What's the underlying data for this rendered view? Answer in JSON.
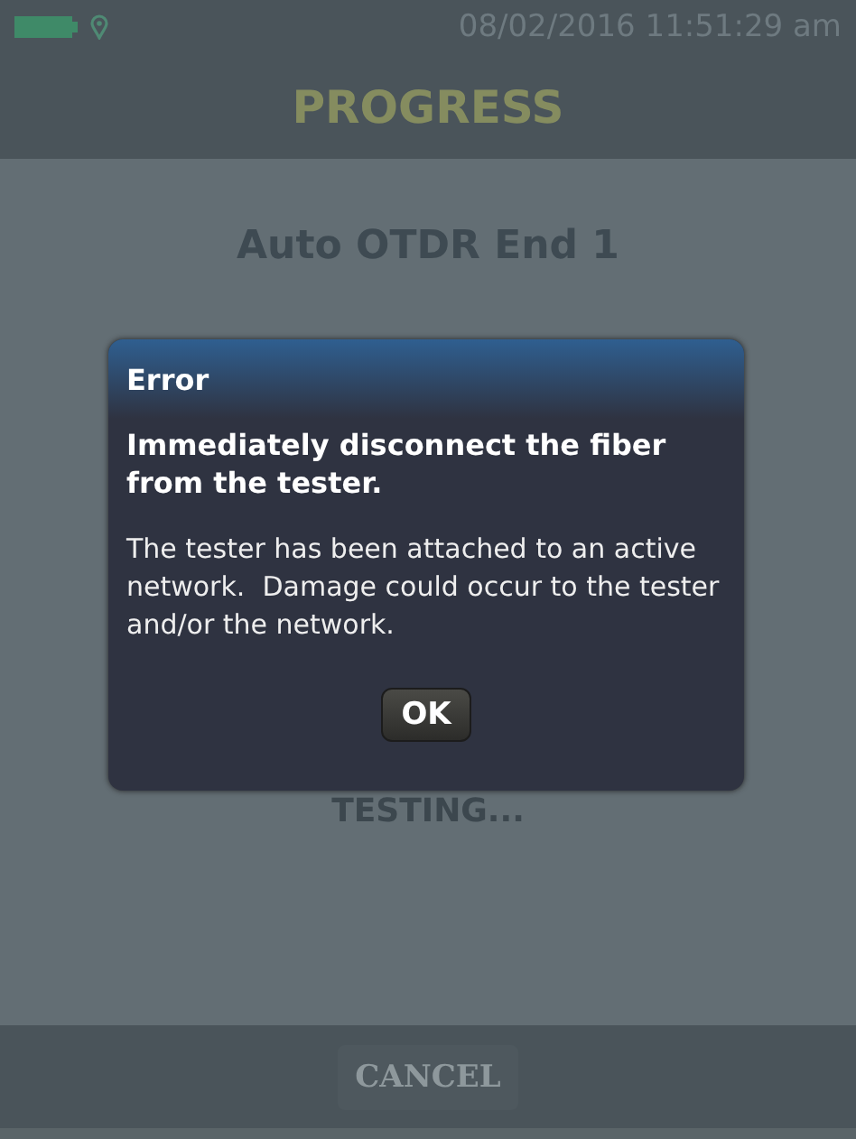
{
  "status_bar": {
    "datetime": "08/02/2016 11:51:29 am"
  },
  "header": {
    "title": "PROGRESS"
  },
  "test_name": "Auto OTDR End 1",
  "status_text": "TESTING...",
  "footer": {
    "buttons": [
      {
        "label": "CANCEL",
        "disabled": true
      }
    ]
  },
  "dialog": {
    "title": "Error",
    "headline": "Immediately disconnect the fiber from the tester.",
    "message": "The tester has been attached to an active network.  Damage could occur to the tester and/or the network.",
    "buttons": [
      {
        "label": "OK"
      }
    ]
  }
}
